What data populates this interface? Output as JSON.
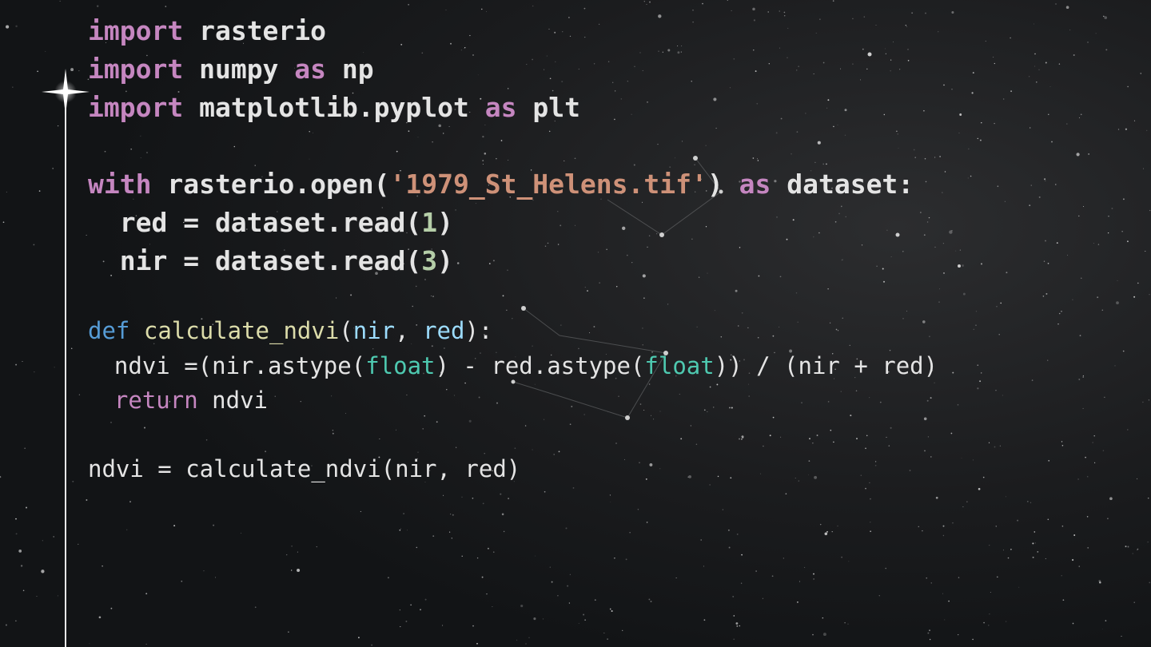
{
  "theme": {
    "background": "#121416",
    "text": "#e4e4e4",
    "keyword": "#c586c0",
    "def_keyword": "#569cd6",
    "function": "#dcdcaa",
    "string": "#ce9178",
    "number": "#b5cea8",
    "parameter": "#9cdcfe",
    "builtin": "#4ec9b0"
  },
  "code": {
    "line1": {
      "kw": "import",
      "rest": " rasterio"
    },
    "line2": {
      "kw": "import",
      "mid": " numpy ",
      "kw2": "as",
      "rest": " np"
    },
    "line3": {
      "kw": "import",
      "mid": " matplotlib.pyplot ",
      "kw2": "as",
      "rest": " plt"
    },
    "line4": {
      "kw": "with",
      "mid": " rasterio.open(",
      "str": "'1979_St_Helens.tif'",
      "mid2": ") ",
      "kw2": "as",
      "rest": " dataset:"
    },
    "line5": {
      "pre": "  red = dataset.read(",
      "num": "1",
      "post": ")"
    },
    "line6": {
      "pre": "  nir = dataset.read(",
      "num": "3",
      "post": ")"
    },
    "line7": {
      "kw": "def",
      "sp": " ",
      "fn": "calculate_ndvi",
      "p1": "(",
      "param1": "nir",
      "comma": ", ",
      "param2": "red",
      "p2": "):"
    },
    "line8": {
      "pre": "  ndvi =(nir.astype(",
      "b1": "float",
      "mid": ") - red.astype(",
      "b2": "float",
      "post": ")) / (nir + red)"
    },
    "line9": {
      "indent": "  ",
      "kw": "return",
      "rest": " ndvi"
    },
    "line10": {
      "text": "ndvi = calculate_ndvi(nir, red)"
    }
  }
}
